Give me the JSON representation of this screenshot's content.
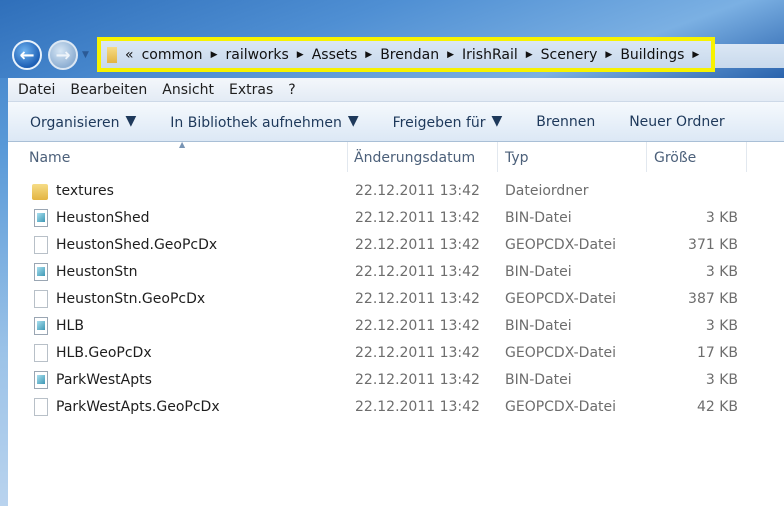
{
  "address": {
    "overflow": "«",
    "crumbs": [
      "common",
      "railworks",
      "Assets",
      "Brendan",
      "IrishRail",
      "Scenery",
      "Buildings"
    ]
  },
  "menu": [
    "Datei",
    "Bearbeiten",
    "Ansicht",
    "Extras",
    "?"
  ],
  "toolbar": {
    "organize": "Organisieren",
    "library": "In Bibliothek aufnehmen",
    "share": "Freigeben für",
    "burn": "Brennen",
    "new_folder": "Neuer Ordner"
  },
  "columns": {
    "name": "Name",
    "date": "Änderungsdatum",
    "type": "Typ",
    "size": "Größe"
  },
  "files": [
    {
      "name": "textures",
      "date": "22.12.2011 13:42",
      "type": "Dateiordner",
      "size": "",
      "icon": "folder"
    },
    {
      "name": "HeustonShed",
      "date": "22.12.2011 13:42",
      "type": "BIN-Datei",
      "size": "3 KB",
      "icon": "bin"
    },
    {
      "name": "HeustonShed.GeoPcDx",
      "date": "22.12.2011 13:42",
      "type": "GEOPCDX-Datei",
      "size": "371 KB",
      "icon": "doc"
    },
    {
      "name": "HeustonStn",
      "date": "22.12.2011 13:42",
      "type": "BIN-Datei",
      "size": "3 KB",
      "icon": "bin"
    },
    {
      "name": "HeustonStn.GeoPcDx",
      "date": "22.12.2011 13:42",
      "type": "GEOPCDX-Datei",
      "size": "387 KB",
      "icon": "doc"
    },
    {
      "name": "HLB",
      "date": "22.12.2011 13:42",
      "type": "BIN-Datei",
      "size": "3 KB",
      "icon": "bin"
    },
    {
      "name": "HLB.GeoPcDx",
      "date": "22.12.2011 13:42",
      "type": "GEOPCDX-Datei",
      "size": "17 KB",
      "icon": "doc"
    },
    {
      "name": "ParkWestApts",
      "date": "22.12.2011 13:42",
      "type": "BIN-Datei",
      "size": "3 KB",
      "icon": "bin"
    },
    {
      "name": "ParkWestApts.GeoPcDx",
      "date": "22.12.2011 13:42",
      "type": "GEOPCDX-Datei",
      "size": "42 KB",
      "icon": "doc"
    }
  ]
}
